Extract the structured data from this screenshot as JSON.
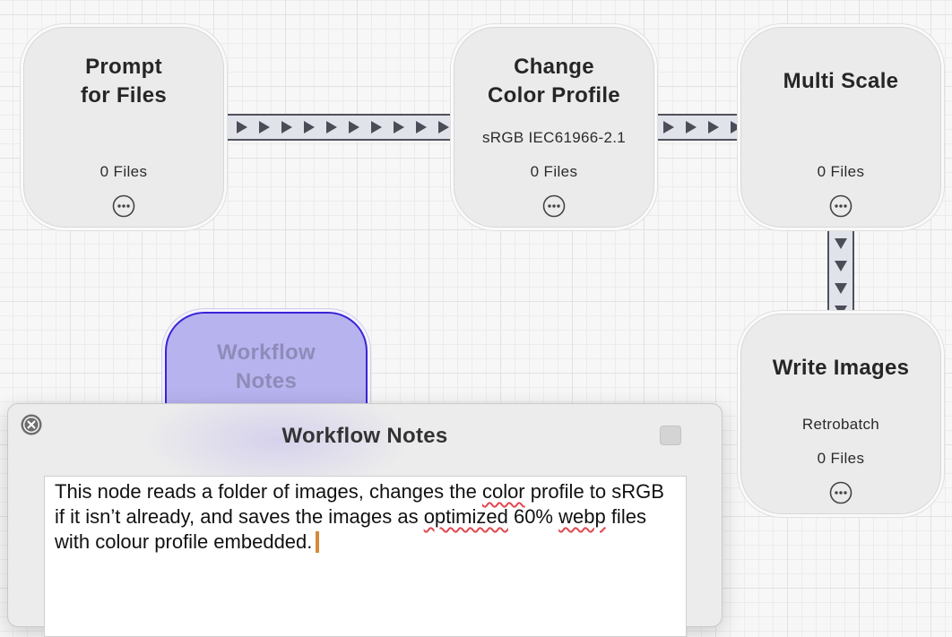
{
  "nodes": {
    "prompt_for_files": {
      "title_line1": "Prompt",
      "title_line2": "for Files",
      "files": "0 Files"
    },
    "change_color_profile": {
      "title_line1": "Change",
      "title_line2": "Color Profile",
      "setting": "sRGB IEC61966-2.1",
      "files": "0 Files"
    },
    "multi_scale": {
      "title": "Multi Scale",
      "files": "0 Files"
    },
    "write_images": {
      "title": "Write Images",
      "setting": "Retrobatch",
      "files": "0 Files"
    },
    "workflow_notes": {
      "title_line1": "Workflow",
      "title_line2": "Notes"
    }
  },
  "popover": {
    "title": "Workflow Notes",
    "notes": {
      "seg1": "This node reads a folder of images, changes the ",
      "seg2": "color",
      "seg3": " profile to sRGB if it isn’t already, and saves the images as ",
      "seg4": "optimized",
      "seg5": " 60% ",
      "seg6": "webp",
      "seg7": " files with colour profile embedded."
    }
  },
  "colors": {
    "selected_node_fill": "#b7b3ef",
    "selected_node_border": "#3b23d6",
    "connector_border": "#50505c",
    "caret": "#d58a3a"
  },
  "icons": [
    "ellipsis-circle-icon",
    "close-circle-icon",
    "play-arrow-icon"
  ]
}
